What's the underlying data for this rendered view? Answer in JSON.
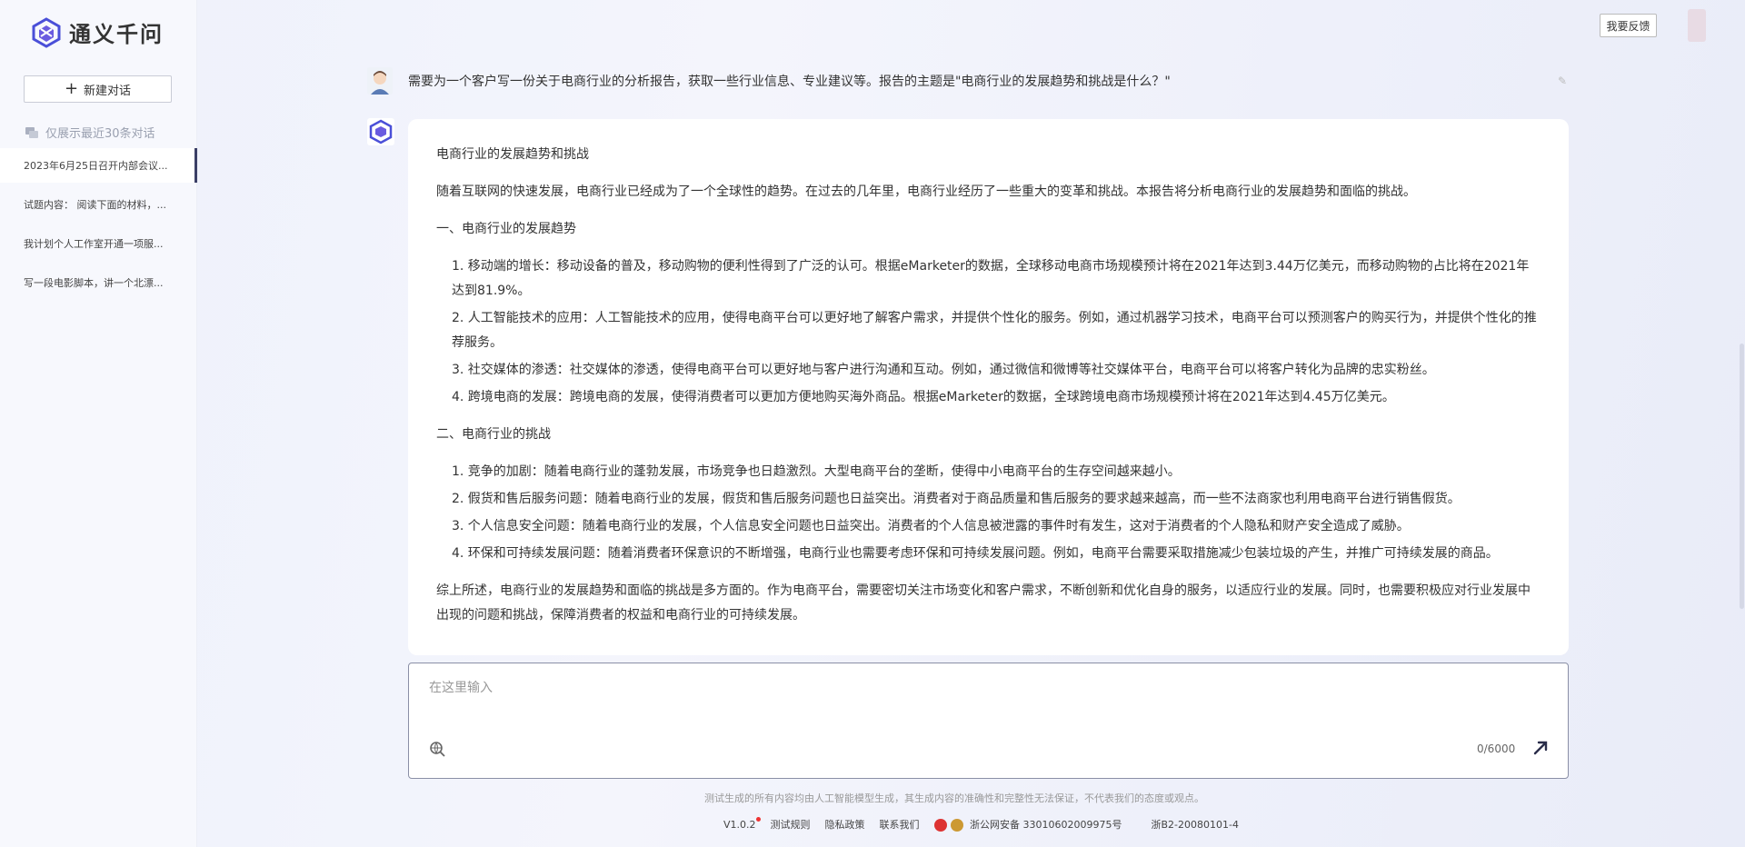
{
  "app": {
    "name": "通义千问"
  },
  "sidebar": {
    "new_chat_label": "新建对话",
    "history_note": "仅展示最近30条对话",
    "items": [
      {
        "label": "2023年6月25日召开内部会议..."
      },
      {
        "label": "试题内容： 阅读下面的材料，..."
      },
      {
        "label": "我计划个人工作室开通一项服..."
      },
      {
        "label": "写一段电影脚本，讲一个北漂..."
      }
    ]
  },
  "header": {
    "feedback_label": "我要反馈"
  },
  "conversation": {
    "user_message": "需要为一个客户写一份关于电商行业的分析报告，获取一些行业信息、专业建议等。报告的主题是\"电商行业的发展趋势和挑战是什么？\"",
    "answer": {
      "title": "电商行业的发展趋势和挑战",
      "intro": "随着互联网的快速发展，电商行业已经成为了一个全球性的趋势。在过去的几年里，电商行业经历了一些重大的变革和挑战。本报告将分析电商行业的发展趋势和面临的挑战。",
      "section1_title": "一、电商行业的发展趋势",
      "section1_items": [
        "1. 移动端的增长：移动设备的普及，移动购物的便利性得到了广泛的认可。根据eMarketer的数据，全球移动电商市场规模预计将在2021年达到3.44万亿美元，而移动购物的占比将在2021年达到81.9%。",
        "2. 人工智能技术的应用：人工智能技术的应用，使得电商平台可以更好地了解客户需求，并提供个性化的服务。例如，通过机器学习技术，电商平台可以预测客户的购买行为，并提供个性化的推荐服务。",
        "3. 社交媒体的渗透：社交媒体的渗透，使得电商平台可以更好地与客户进行沟通和互动。例如，通过微信和微博等社交媒体平台，电商平台可以将客户转化为品牌的忠实粉丝。",
        "4. 跨境电商的发展：跨境电商的发展，使得消费者可以更加方便地购买海外商品。根据eMarketer的数据，全球跨境电商市场规模预计将在2021年达到4.45万亿美元。"
      ],
      "section2_title": "二、电商行业的挑战",
      "section2_items": [
        "1. 竞争的加剧：随着电商行业的蓬勃发展，市场竞争也日趋激烈。大型电商平台的垄断，使得中小电商平台的生存空间越来越小。",
        "2. 假货和售后服务问题：随着电商行业的发展，假货和售后服务问题也日益突出。消费者对于商品质量和售后服务的要求越来越高，而一些不法商家也利用电商平台进行销售假货。",
        "3. 个人信息安全问题：随着电商行业的发展，个人信息安全问题也日益突出。消费者的个人信息被泄露的事件时有发生，这对于消费者的个人隐私和财产安全造成了威胁。",
        "4. 环保和可持续发展问题：随着消费者环保意识的不断增强，电商行业也需要考虑环保和可持续发展问题。例如，电商平台需要采取措施减少包装垃圾的产生，并推广可持续发展的商品。"
      ],
      "conclusion": "综上所述，电商行业的发展趋势和面临的挑战是多方面的。作为电商平台，需要密切关注市场变化和客户需求，不断创新和优化自身的服务，以适应行业的发展。同时，也需要积极应对行业发展中出现的问题和挑战，保障消费者的权益和电商行业的可持续发展。"
    }
  },
  "input": {
    "placeholder": "在这里输入",
    "counter": "0/6000"
  },
  "disclaimer": "测试生成的所有内容均由人工智能模型生成，其生成内容的准确性和完整性无法保证，不代表我们的态度或观点。",
  "footer": {
    "version": "V1.0.2",
    "rules": "测试规则",
    "privacy": "隐私政策",
    "contact": "联系我们",
    "police_record": "浙公网安备 33010602009975号",
    "icp": "浙B2-20080101-4"
  },
  "colors": {
    "accent": "#3b3f66",
    "logo_purple": "#5b4fd1"
  }
}
